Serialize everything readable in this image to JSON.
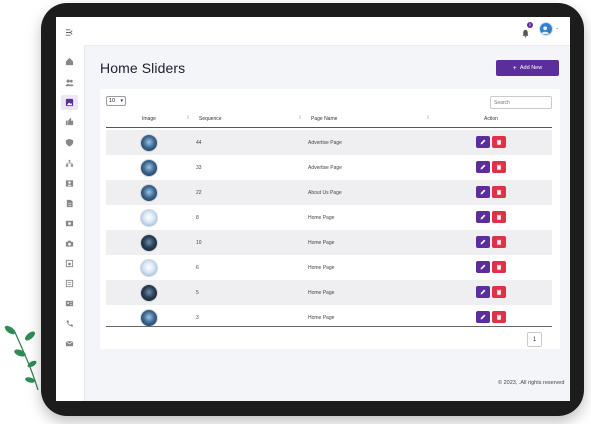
{
  "header": {
    "notification_count": "0"
  },
  "page": {
    "title": "Home Sliders",
    "add_button_label": "Add New"
  },
  "table_controls": {
    "page_length": "10",
    "search_placeholder": "Search"
  },
  "table": {
    "columns": [
      "Image",
      "Sequence",
      "Page Name",
      "Action"
    ],
    "rows": [
      {
        "sequence": "44",
        "page_name": "Advertise Page"
      },
      {
        "sequence": "33",
        "page_name": "Advertise Page"
      },
      {
        "sequence": "22",
        "page_name": "About Us Page"
      },
      {
        "sequence": "8",
        "page_name": "Home Page"
      },
      {
        "sequence": "10",
        "page_name": "Home Page"
      },
      {
        "sequence": "6",
        "page_name": "Home Page"
      },
      {
        "sequence": "5",
        "page_name": "Home Page"
      },
      {
        "sequence": "3",
        "page_name": "Home Page"
      }
    ]
  },
  "pagination": {
    "current_page": "1"
  },
  "footer": {
    "text": "© 2023, .All rights reserved"
  },
  "colors": {
    "primary": "#5b2e9c",
    "danger": "#e0314b"
  }
}
